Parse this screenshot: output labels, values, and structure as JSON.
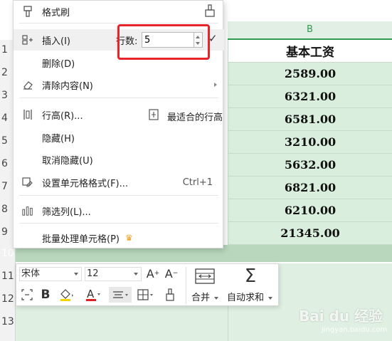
{
  "sheet": {
    "column_b_header": "B",
    "row_numbers": [
      "1",
      "2",
      "3",
      "4",
      "5",
      "6",
      "7",
      "8",
      "9",
      "10",
      "11",
      "12",
      "13"
    ],
    "col_b_values": [
      "基本工资",
      "2589.00",
      "6321.00",
      "6581.00",
      "3210.00",
      "5632.00",
      "6821.00",
      "6210.00",
      "21345.00"
    ]
  },
  "context_menu": {
    "format_painter": "格式刷",
    "insert": "插入(I)",
    "rows_label": "行数:",
    "rows_value": "5",
    "delete": "删除(D)",
    "clear_contents": "清除内容(N)",
    "row_height": "行高(R)...",
    "best_fit_row_height": "最适合的行高",
    "hide": "隐藏(H)",
    "unhide": "取消隐藏(U)",
    "format_cells": "设置单元格格式(F)...",
    "format_cells_shortcut": "Ctrl+1",
    "filter_columns": "筛选列(L)...",
    "batch_process": "批量处理单元格(P)"
  },
  "toolbar": {
    "font": "宋体",
    "size": "12",
    "merge": "合并",
    "autosum": "自动求和"
  },
  "watermark": {
    "brand": "Bai du 经验",
    "url": "jingyan.baidu.com"
  },
  "colors": {
    "accent_red": "#e8232a",
    "sheet_green": "#d9eedd",
    "header_green": "#2f9a4f"
  }
}
